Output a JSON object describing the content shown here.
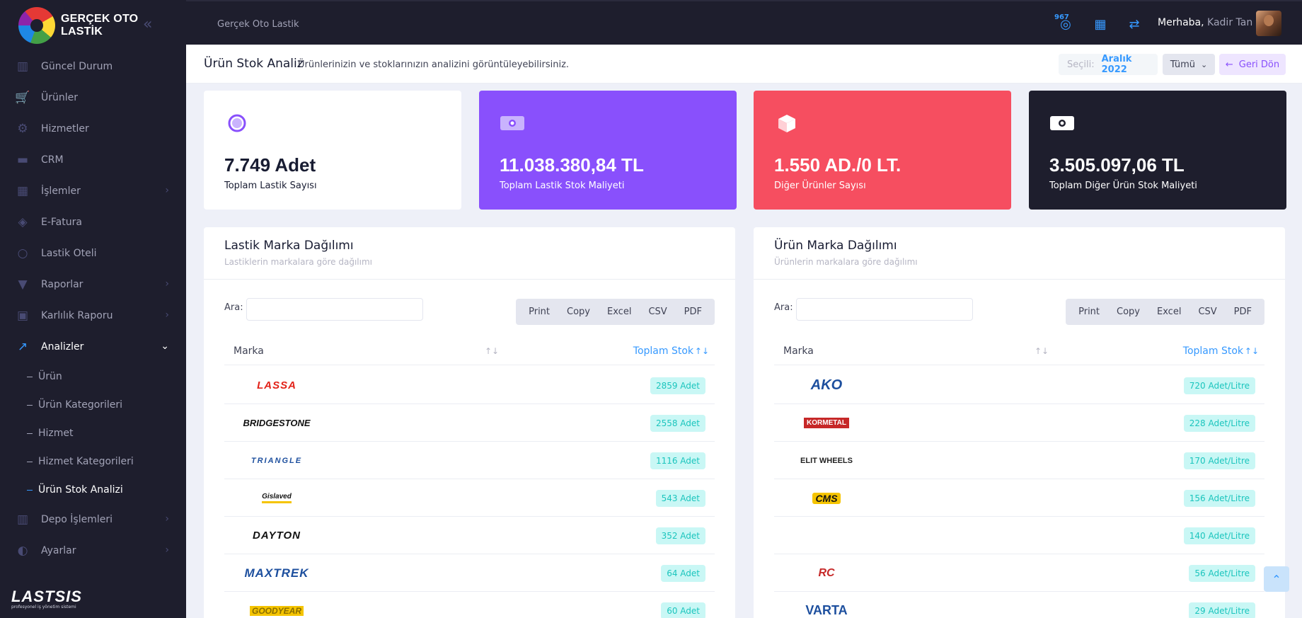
{
  "brand": {
    "name": "GERÇEK OTO LASTİK",
    "collapse_icon": "double-chevron-left-icon"
  },
  "sidebar": {
    "items": [
      {
        "label": "Güncel Durum",
        "icon": "chart-icon"
      },
      {
        "label": "Ürünler",
        "icon": "cart-icon"
      },
      {
        "label": "Hizmetler",
        "icon": "gear-icon"
      },
      {
        "label": "CRM",
        "icon": "briefcase-icon"
      },
      {
        "label": "İşlemler",
        "icon": "calculator-icon"
      },
      {
        "label": "E-Fatura",
        "icon": "tag-icon"
      },
      {
        "label": "Lastik Oteli",
        "icon": "circle-icon"
      },
      {
        "label": "Raporlar",
        "icon": "filter-icon"
      },
      {
        "label": "Karlılık Raporu",
        "icon": "money-icon"
      },
      {
        "label": "Analizler",
        "icon": "line-chart-icon"
      }
    ],
    "sub_items": [
      "Ürün",
      "Ürün Kategorileri",
      "Hizmet",
      "Hizmet Kategorileri",
      "Ürün Stok Analizi"
    ],
    "bottom_items": [
      {
        "label": "Depo İşlemleri",
        "icon": "barcode-icon"
      },
      {
        "label": "Ayarlar",
        "icon": "toggle-icon"
      }
    ],
    "footer": {
      "logo": "LASTSIS",
      "tagline": "profesyonel iş yönetim sistemi"
    }
  },
  "header": {
    "breadcrumb": "Gerçek Oto Lastik",
    "notification_count": "967",
    "greeting": "Merhaba,",
    "user_name": "Kadir Tan"
  },
  "subheader": {
    "title": "Ürün Stok Analiz",
    "description": "Ürünlerinizin ve stoklarınızın analizini görüntüleyebilirsiniz.",
    "selected_label": "Seçili:",
    "selected_value": "Aralık 2022",
    "filter_label": "Tümü",
    "back_label": "Geri Dön"
  },
  "stats": [
    {
      "value": "7.749 Adet",
      "label": "Toplam Lastik Sayısı",
      "color": "#ffffff"
    },
    {
      "value": "11.038.380,84 TL",
      "label": "Toplam Lastik Stok Maliyeti",
      "color": "#8950fc"
    },
    {
      "value": "1.550 AD./0 LT.",
      "label": "Diğer Ürünler Sayısı",
      "color": "#f64e60"
    },
    {
      "value": "3.505.097,06 TL",
      "label": "Toplam Diğer Ürün Stok Maliyeti",
      "color": "#1e1e2d"
    }
  ],
  "export_buttons": [
    "Print",
    "Copy",
    "Excel",
    "CSV",
    "PDF"
  ],
  "tire_panel": {
    "title": "Lastik Marka Dağılımı",
    "subtitle": "Lastiklerin markalara göre dağılımı",
    "search_label": "Ara:",
    "col_brand": "Marka",
    "col_stock": "Toplam Stok",
    "rows": [
      {
        "brand": "LASSA",
        "stock": "2859 Adet"
      },
      {
        "brand": "BRIDGESTONE",
        "stock": "2558 Adet"
      },
      {
        "brand": "TRIANGLE",
        "stock": "1116 Adet"
      },
      {
        "brand": "Gislaved",
        "stock": "543 Adet"
      },
      {
        "brand": "DAYTON",
        "stock": "352 Adet"
      },
      {
        "brand": "MAXTREK",
        "stock": "64 Adet"
      },
      {
        "brand": "GOODYEAR",
        "stock": "60 Adet"
      }
    ]
  },
  "product_panel": {
    "title": "Ürün Marka Dağılımı",
    "subtitle": "Ürünlerin markalara göre dağılımı",
    "search_label": "Ara:",
    "col_brand": "Marka",
    "col_stock": "Toplam Stok",
    "rows": [
      {
        "brand": "AKO",
        "stock": "720 Adet/Litre"
      },
      {
        "brand": "KORMETAL",
        "stock": "228 Adet/Litre"
      },
      {
        "brand": "ELIT WHEELS",
        "stock": "170 Adet/Litre"
      },
      {
        "brand": "CMS",
        "stock": "156 Adet/Litre"
      },
      {
        "brand": "",
        "stock": "140 Adet/Litre"
      },
      {
        "brand": "RC",
        "stock": "56 Adet/Litre"
      },
      {
        "brand": "VARTA",
        "stock": "29 Adet/Litre"
      }
    ]
  }
}
